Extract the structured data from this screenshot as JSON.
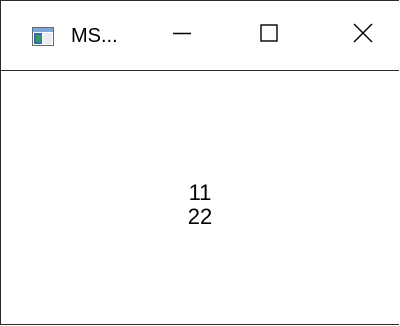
{
  "window": {
    "title": "MS...",
    "app_icon": "window-app-icon"
  },
  "caption_buttons": {
    "minimize_icon": "minimize-icon",
    "maximize_icon": "maximize-icon",
    "close_icon": "close-icon"
  },
  "content": {
    "line1": "11",
    "line2": "22"
  },
  "colors": {
    "border": "#2b2b2b",
    "background": "#ffffff",
    "text": "#000000"
  }
}
